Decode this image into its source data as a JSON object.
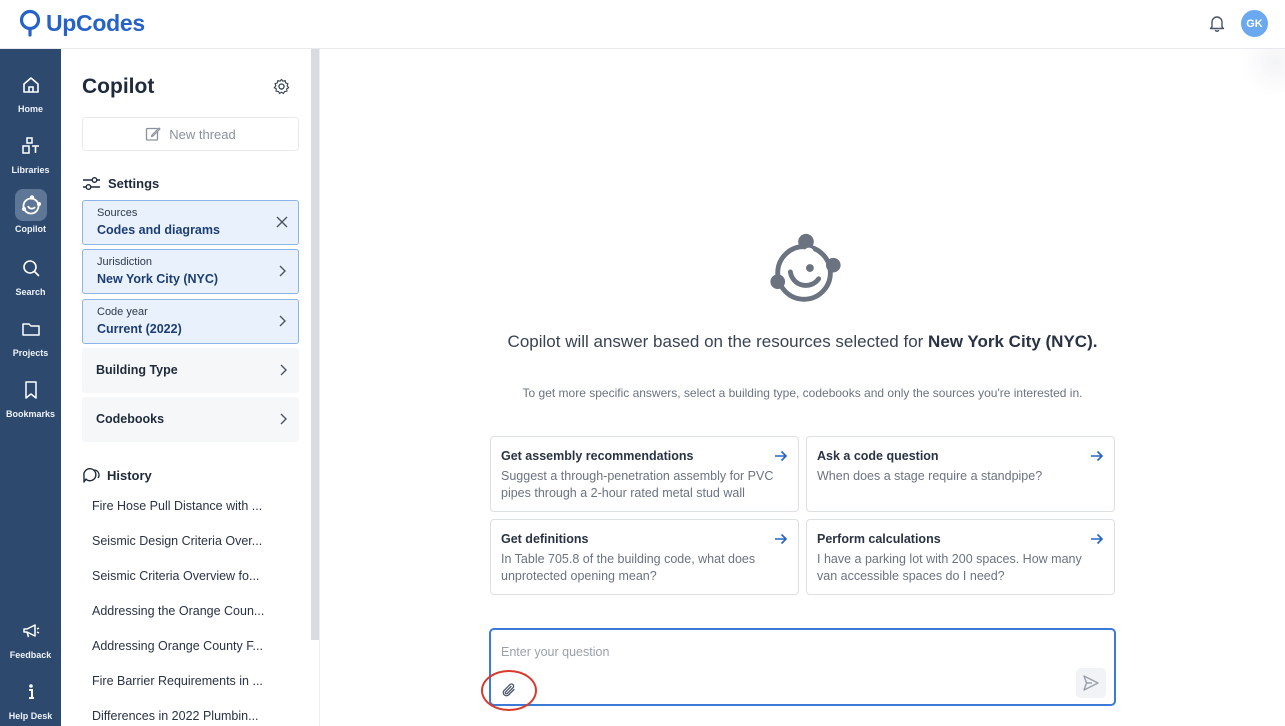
{
  "app": {
    "name": "UpCodes",
    "user_initials": "GK"
  },
  "colors": {
    "brand": "#2563c9",
    "rail": "#2d4a6e",
    "selected_bg": "#e8f1fc",
    "annotation_ring": "#d83a2e"
  },
  "rail": {
    "items": [
      {
        "label": "Home",
        "icon": "home-icon"
      },
      {
        "label": "Libraries",
        "icon": "libraries-icon"
      },
      {
        "label": "Copilot",
        "icon": "copilot-icon",
        "active": true
      },
      {
        "label": "Search",
        "icon": "search-icon"
      },
      {
        "label": "Projects",
        "icon": "folder-icon"
      },
      {
        "label": "Bookmarks",
        "icon": "bookmark-icon"
      },
      {
        "label": "Feedback",
        "icon": "megaphone-icon"
      },
      {
        "label": "Help Desk",
        "icon": "info-icon"
      }
    ]
  },
  "sidebar": {
    "title": "Copilot",
    "new_thread": "New thread",
    "settings_heading": "Settings",
    "options": [
      {
        "label": "Sources",
        "value": "Codes and diagrams",
        "action": "close-icon"
      },
      {
        "label": "Jurisdiction",
        "value": "New York City (NYC)",
        "action": "chevron-right-icon"
      },
      {
        "label": "Code year",
        "value": "Current (2022)",
        "action": "chevron-right-icon"
      },
      {
        "title": "Building Type",
        "action": "chevron-right-icon"
      },
      {
        "title": "Codebooks",
        "action": "chevron-right-icon"
      }
    ],
    "history_heading": "History",
    "history": [
      "Fire Hose Pull Distance with ...",
      "Seismic Design Criteria Over...",
      "Seismic Criteria Overview fo...",
      "Addressing the Orange Coun...",
      "Addressing Orange County F...",
      "Fire Barrier Requirements in ...",
      "Differences in 2022 Plumbin..."
    ]
  },
  "main": {
    "headline_prefix": "Copilot will answer based on the resources selected for ",
    "headline_bold": "New York City (NYC).",
    "subline": "To get more specific answers, select a building type, codebooks and only the sources you're interested in.",
    "cards": [
      {
        "title": "Get assembly recommendations",
        "body": "Suggest a through-penetration assembly for PVC pipes through a 2-hour rated metal stud wall"
      },
      {
        "title": "Ask a code question",
        "body": "When does a stage require a standpipe?"
      },
      {
        "title": "Get definitions",
        "body": "In Table 705.8 of the building code, what does unprotected opening mean?"
      },
      {
        "title": "Perform calculations",
        "body": "I have a parking lot with 200 spaces. How many van accessible spaces do I need?"
      }
    ],
    "input": {
      "placeholder": "Enter your question",
      "value": ""
    }
  }
}
